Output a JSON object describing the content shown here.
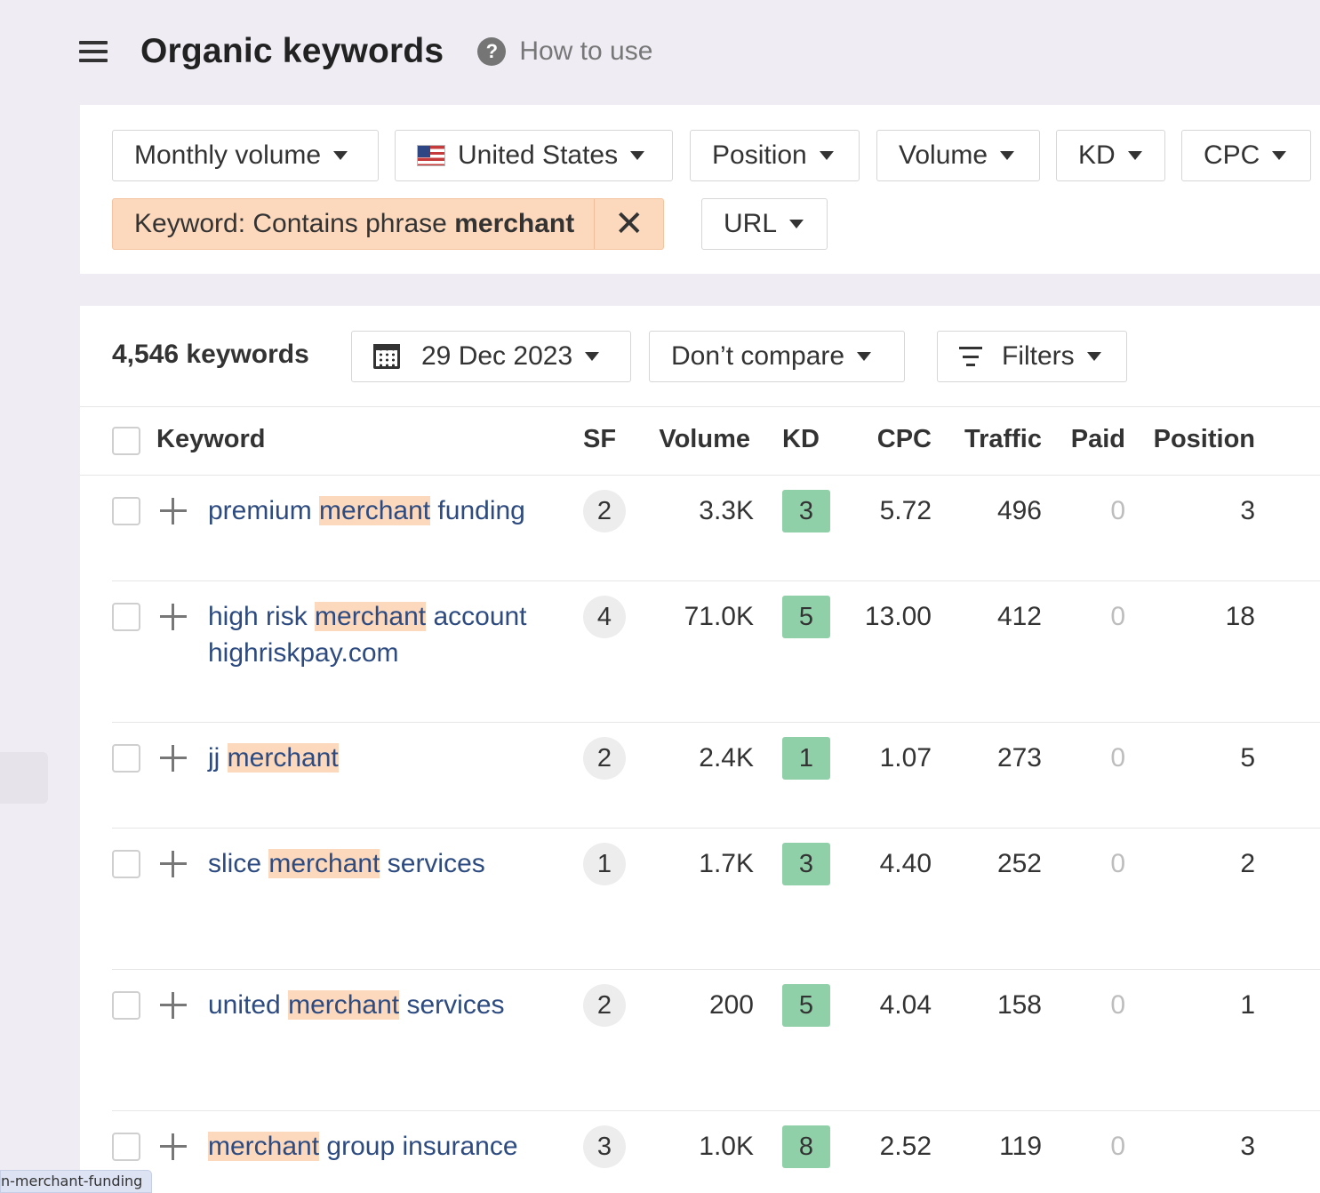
{
  "header": {
    "title": "Organic keywords",
    "help_label": "How to use"
  },
  "filters": {
    "monthly_volume": "Monthly volume",
    "country": "United States",
    "position": "Position",
    "volume": "Volume",
    "kd": "KD",
    "cpc": "CPC",
    "active_filter_prefix": "Keyword: Contains phrase ",
    "active_filter_value": "merchant",
    "url": "URL"
  },
  "toolbar": {
    "count": "4,546 keywords",
    "date": "29 Dec 2023",
    "compare": "Don’t compare",
    "filters": "Filters"
  },
  "columns": {
    "keyword": "Keyword",
    "sf": "SF",
    "volume": "Volume",
    "kd": "KD",
    "cpc": "CPC",
    "traffic": "Traffic",
    "paid": "Paid",
    "position": "Position"
  },
  "rows": [
    {
      "kw_pre": "premium ",
      "kw_hl": "merchant",
      "kw_post": " funding",
      "sf": "2",
      "volume": "3.3K",
      "kd": "3",
      "cpc": "5.72",
      "traffic": "496",
      "paid": "0",
      "position": "3"
    },
    {
      "kw_pre": "high risk ",
      "kw_hl": "merchant",
      "kw_post": " account highriskpay.com",
      "sf": "4",
      "volume": "71.0K",
      "kd": "5",
      "cpc": "13.00",
      "traffic": "412",
      "paid": "0",
      "position": "18"
    },
    {
      "kw_pre": "jj ",
      "kw_hl": "merchant",
      "kw_post": "",
      "sf": "2",
      "volume": "2.4K",
      "kd": "1",
      "cpc": "1.07",
      "traffic": "273",
      "paid": "0",
      "position": "5"
    },
    {
      "kw_pre": "slice ",
      "kw_hl": "merchant",
      "kw_post": " services",
      "sf": "1",
      "volume": "1.7K",
      "kd": "3",
      "cpc": "4.40",
      "traffic": "252",
      "paid": "0",
      "position": "2"
    },
    {
      "kw_pre": "united ",
      "kw_hl": "merchant",
      "kw_post": " services",
      "sf": "2",
      "volume": "200",
      "kd": "5",
      "cpc": "4.04",
      "traffic": "158",
      "paid": "0",
      "position": "1"
    },
    {
      "kw_pre": "",
      "kw_hl": "merchant",
      "kw_post": " group insurance",
      "sf": "3",
      "volume": "1.0K",
      "kd": "8",
      "cpc": "2.52",
      "traffic": "119",
      "paid": "0",
      "position": "3"
    }
  ],
  "status_bar": {
    "url": "n-merchant-funding"
  },
  "colors": {
    "highlight": "#fcd9bd",
    "kd_easy": "#8fd0a8",
    "link": "#2d4b80"
  }
}
